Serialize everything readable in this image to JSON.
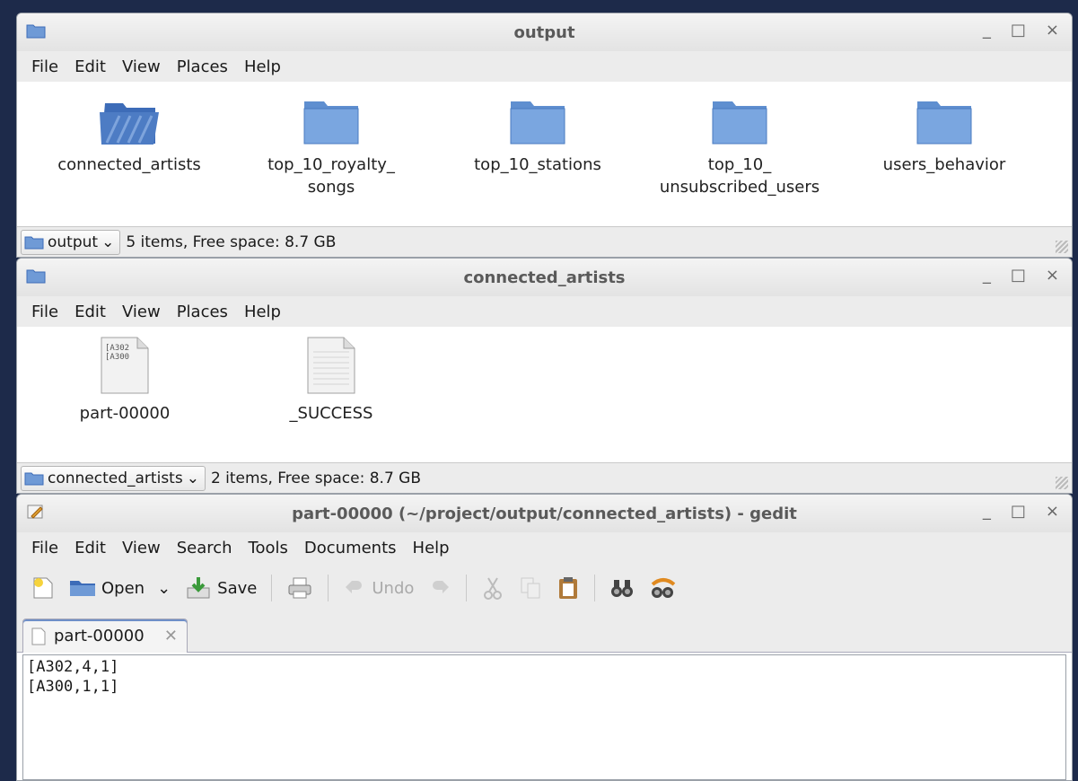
{
  "colors": {
    "folder": "#6f9ad6",
    "folder_dark": "#3d6cb8",
    "titlebar": "#e6e6e6",
    "desktop": "#1d2a4a"
  },
  "window1": {
    "title": "output",
    "controls": [
      "_",
      "□",
      "×"
    ],
    "menu": [
      "File",
      "Edit",
      "View",
      "Places",
      "Help"
    ],
    "items": [
      {
        "line1": "connected_artists",
        "line2": "",
        "icon": "folder-selected-icon"
      },
      {
        "line1": "top_10_royalty_",
        "line2": "songs",
        "icon": "folder-icon"
      },
      {
        "line1": "top_10_stations",
        "line2": "",
        "icon": "folder-icon"
      },
      {
        "line1": "top_10_",
        "line2": "unsubscribed_users",
        "icon": "folder-icon"
      },
      {
        "line1": "users_behavior",
        "line2": "",
        "icon": "folder-icon"
      }
    ],
    "location": "output",
    "status": "5 items, Free space: 8.7 GB"
  },
  "window2": {
    "title": "connected_artists",
    "controls": [
      "_",
      "□",
      "×"
    ],
    "menu": [
      "File",
      "Edit",
      "View",
      "Places",
      "Help"
    ],
    "items": [
      {
        "label": "part-00000",
        "preview1": "[A302",
        "preview2": "[A300",
        "icon": "text-file-icon"
      },
      {
        "label": "_SUCCESS",
        "icon": "empty-file-icon"
      }
    ],
    "location": "connected_artists",
    "status": "2 items, Free space: 8.7 GB"
  },
  "window3": {
    "title": "part-00000 (~/project/output/connected_artists) - gedit",
    "controls": [
      "_",
      "□",
      "×"
    ],
    "menu": [
      "File",
      "Edit",
      "View",
      "Search",
      "Tools",
      "Documents",
      "Help"
    ],
    "toolbar": {
      "open": "Open",
      "save": "Save",
      "undo": "Undo"
    },
    "tab": "part-00000",
    "content": "[A302,4,1]\n[A300,1,1]"
  }
}
